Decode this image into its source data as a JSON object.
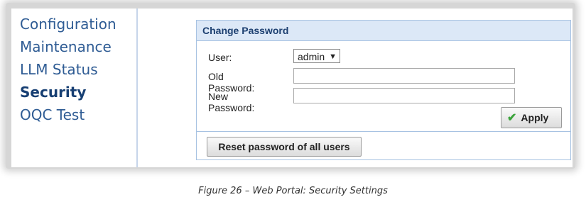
{
  "sidebar": {
    "items": [
      {
        "label": "Configuration",
        "active": false
      },
      {
        "label": "Maintenance",
        "active": false
      },
      {
        "label": "LLM Status",
        "active": false
      },
      {
        "label": "Security",
        "active": true
      },
      {
        "label": "OQC Test",
        "active": false
      }
    ]
  },
  "panel": {
    "title": "Change Password",
    "user_label": "User:",
    "user_value": "admin",
    "old_password_label": "Old Password:",
    "old_password_value": "",
    "new_password_label": "New Password:",
    "new_password_value": "",
    "apply_label": "Apply",
    "reset_label": "Reset password of all users"
  },
  "icons": {
    "apply": "checkmark-icon",
    "dropdown": "caret-down-icon"
  },
  "colors": {
    "nav_text": "#2f5c94",
    "nav_active": "#173f73",
    "panel_header_bg": "#dce8f7",
    "panel_border": "#a7c2e2",
    "apply_check": "#3aa33a"
  },
  "caption": "Figure 26 – Web Portal: Security Settings"
}
